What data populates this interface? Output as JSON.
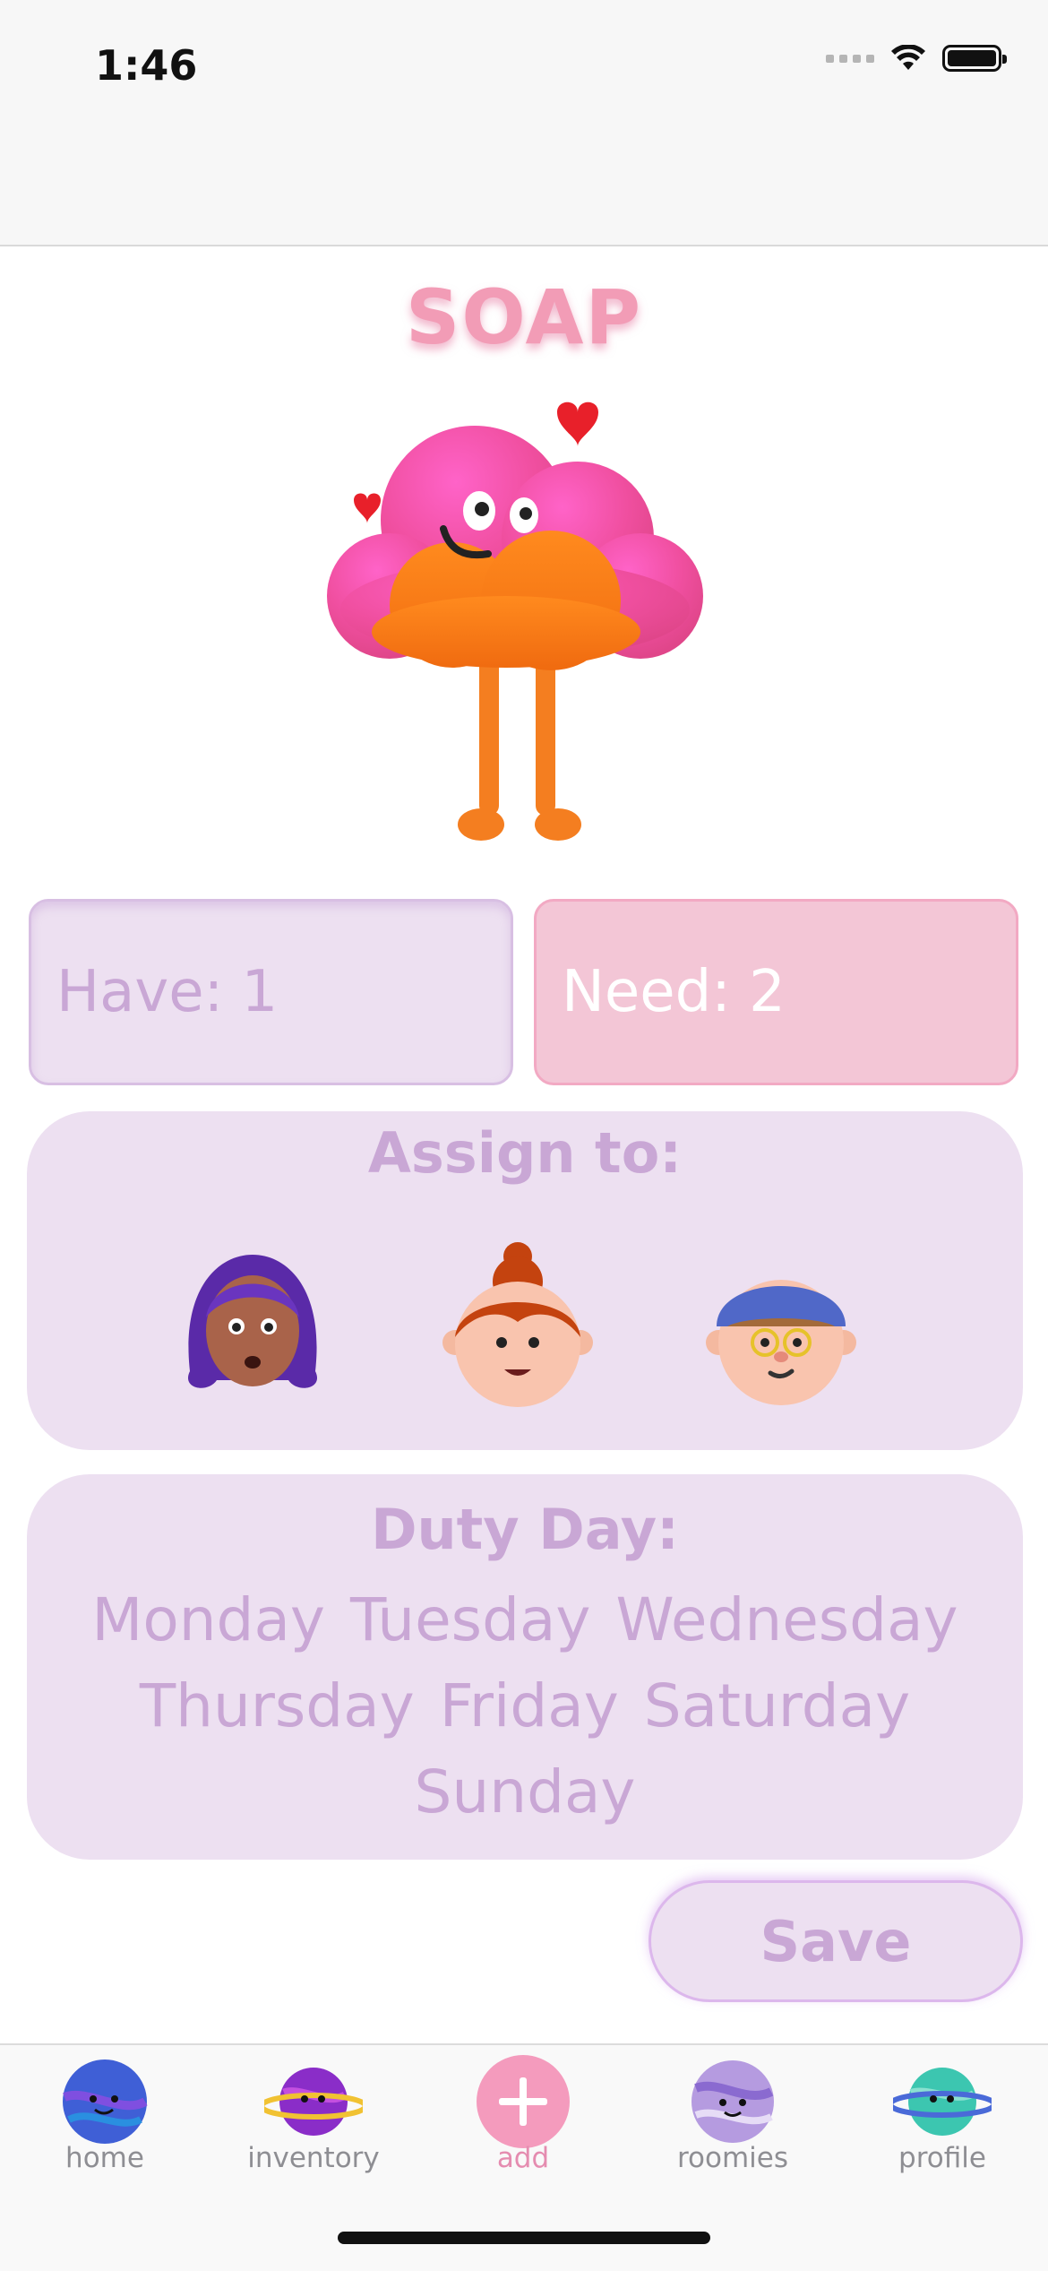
{
  "status_bar": {
    "time": "1:46"
  },
  "item": {
    "title": "SOAP"
  },
  "quantities": {
    "have_label": "Have: 1",
    "need_label": "Need: 2"
  },
  "assign": {
    "label": "Assign to:",
    "people": [
      {
        "icon": "avatar-purple-hair-icon"
      },
      {
        "icon": "avatar-red-bun-icon"
      },
      {
        "icon": "avatar-blue-cap-glasses-icon"
      }
    ]
  },
  "duty": {
    "label": "Duty Day:",
    "days": [
      "Monday",
      "Tuesday",
      "Wednesday",
      "Thursday",
      "Friday",
      "Saturday",
      "Sunday"
    ]
  },
  "save_label": "Save",
  "tabs": [
    {
      "label": "home",
      "icon": "planet-blue-icon"
    },
    {
      "label": "inventory",
      "icon": "planet-purple-ring-icon"
    },
    {
      "label": "add",
      "icon": "plus-circle-icon",
      "active": true
    },
    {
      "label": "roomies",
      "icon": "planet-lavender-icon"
    },
    {
      "label": "profile",
      "icon": "planet-teal-ring-icon"
    }
  ],
  "colors": {
    "accent_pink": "#f29cb6",
    "panel_lavender": "#ede0f1",
    "label_lavender": "#c9a7d5"
  }
}
